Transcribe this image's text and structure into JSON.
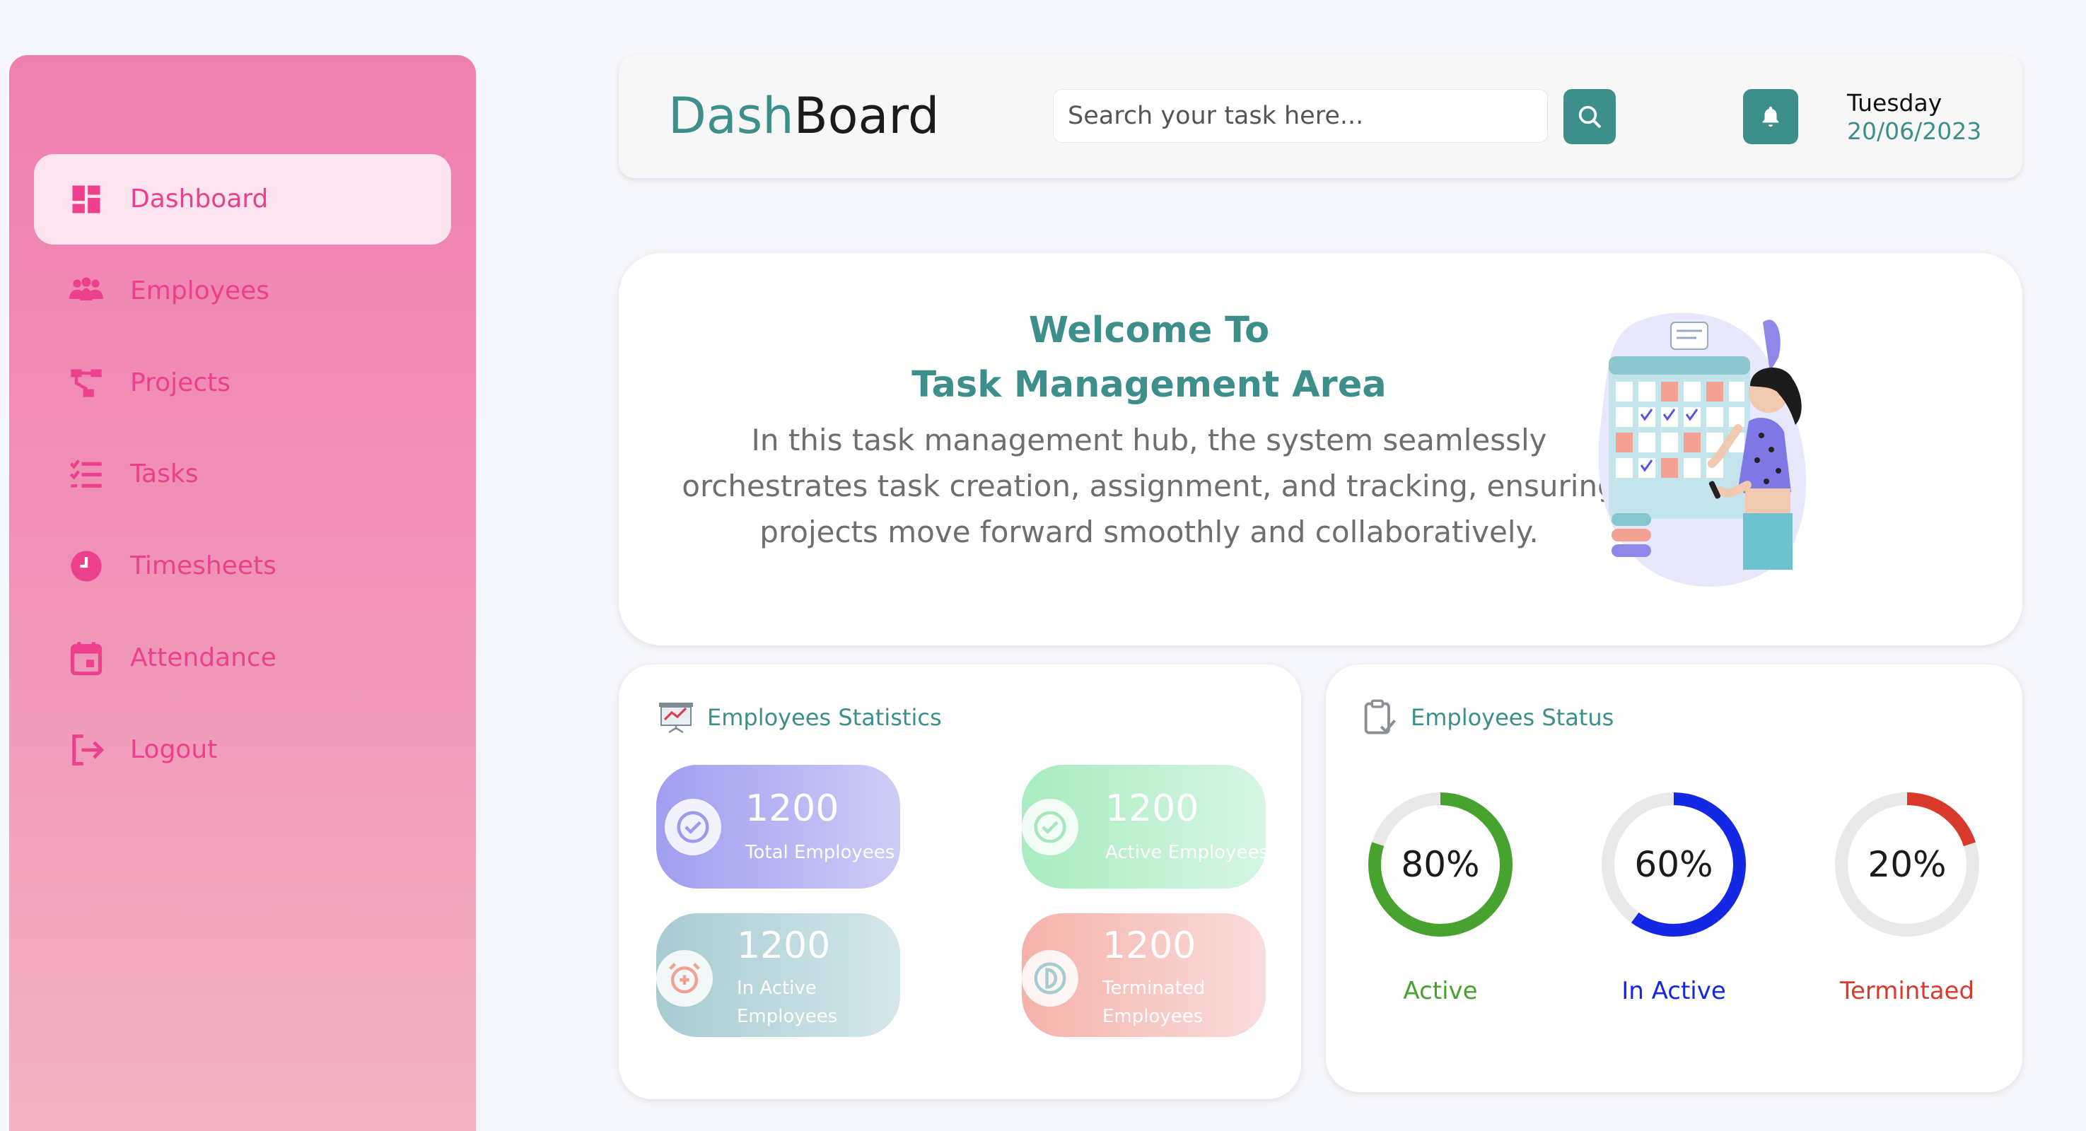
{
  "sidebar": {
    "items": [
      {
        "label": "Dashboard",
        "icon": "dashboard-icon",
        "active": true
      },
      {
        "label": "Employees",
        "icon": "employees-icon"
      },
      {
        "label": "Projects",
        "icon": "projects-icon"
      },
      {
        "label": "Tasks",
        "icon": "tasks-icon"
      },
      {
        "label": "Timesheets",
        "icon": "clock-icon"
      },
      {
        "label": "Attendance",
        "icon": "calendar-icon"
      },
      {
        "label": "Logout",
        "icon": "logout-icon"
      }
    ]
  },
  "header": {
    "brand_part1": "Dash",
    "brand_part2": "Board",
    "search_placeholder": "Search your task here...",
    "day": "Tuesday",
    "date": "20/06/2023"
  },
  "welcome": {
    "title_line1": "Welcome To",
    "title_line2": "Task Management Area",
    "text": "In this task management hub, the system seamlessly orchestrates task creation, assignment, and tracking, ensuring projects move forward smoothly and collaboratively."
  },
  "stats": {
    "title": "Employees Statistics",
    "cards": [
      {
        "value": "1200",
        "label": "Total Employees"
      },
      {
        "value": "1200",
        "label": "Active Employees"
      },
      {
        "value": "1200",
        "label_line1": "In Active",
        "label_line2": "Employees"
      },
      {
        "value": "1200",
        "label_line1": "Terminated",
        "label_line2": "Employees"
      }
    ]
  },
  "status": {
    "title": "Employees Status",
    "rings": [
      {
        "value": "80%",
        "percent": 80,
        "label": "Active",
        "color": "#47a22f"
      },
      {
        "value": "60%",
        "percent": 60,
        "label": "In Active",
        "color": "#1428e3"
      },
      {
        "value": "20%",
        "percent": 20,
        "label": "Termintaed",
        "color": "#d93a2b"
      }
    ]
  },
  "colors": {
    "accent": "#3c8f8a",
    "sidebar_text": "#ec3f8c"
  }
}
